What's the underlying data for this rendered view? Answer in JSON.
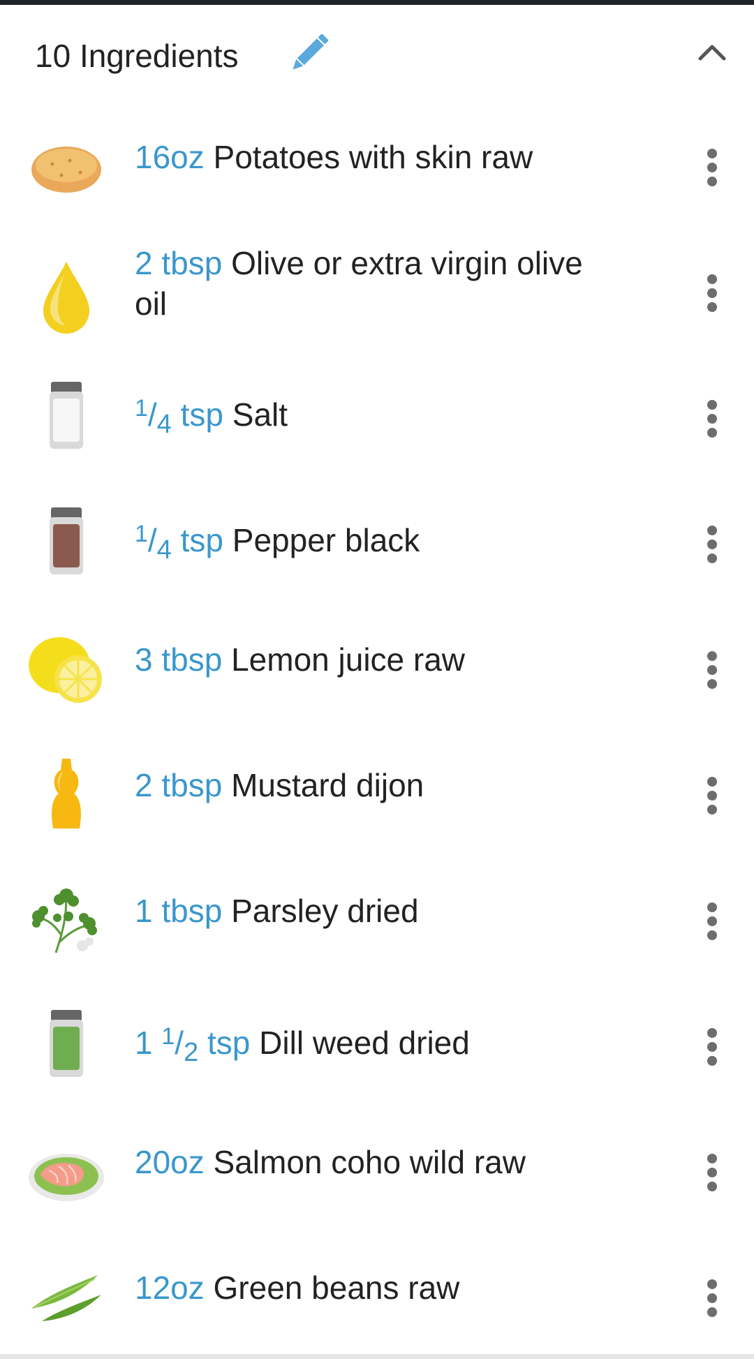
{
  "header": {
    "title": "10 Ingredients",
    "edit_icon": "pencil-icon",
    "collapse_icon": "chevron-up-icon"
  },
  "colors": {
    "quantity": "#3a97cc",
    "text": "#222222",
    "menu_dots": "#6d6d6d"
  },
  "ingredients": [
    {
      "icon": "potato-icon",
      "qty": "16oz",
      "name": "Potatoes with skin raw"
    },
    {
      "icon": "oil-drop-icon",
      "qty": "2 tbsp",
      "name": "Olive or extra virgin olive oil"
    },
    {
      "icon": "salt-shaker-icon",
      "qty_frac": {
        "num": "1",
        "den": "4",
        "unit": "tsp"
      },
      "name": "Salt"
    },
    {
      "icon": "pepper-shaker-icon",
      "qty_frac": {
        "num": "1",
        "den": "4",
        "unit": "tsp"
      },
      "name": "Pepper black"
    },
    {
      "icon": "lemon-icon",
      "qty": "3 tbsp",
      "name": "Lemon juice raw"
    },
    {
      "icon": "mustard-bottle-icon",
      "qty": "2 tbsp",
      "name": "Mustard dijon"
    },
    {
      "icon": "parsley-icon",
      "qty": "1 tbsp",
      "name": "Parsley dried"
    },
    {
      "icon": "dill-jar-icon",
      "qty_frac": {
        "whole": "1",
        "num": "1",
        "den": "2",
        "unit": "tsp"
      },
      "name": "Dill weed dried"
    },
    {
      "icon": "salmon-plate-icon",
      "qty": "20oz",
      "name": "Salmon coho wild raw"
    },
    {
      "icon": "green-beans-icon",
      "qty": "12oz",
      "name": "Green beans raw"
    }
  ]
}
